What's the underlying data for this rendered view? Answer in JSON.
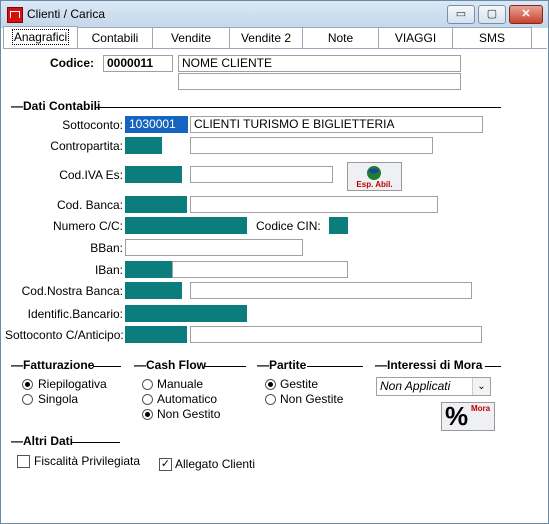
{
  "window": {
    "title": "Clienti / Carica",
    "controls": {
      "minimize": "▭",
      "maximize": "▢",
      "close": "✕"
    }
  },
  "tabs": [
    "Anagrafici",
    "Contabili",
    "Vendite",
    "Vendite 2",
    "Note",
    "VIAGGI",
    "SMS"
  ],
  "header": {
    "codice_label": "Codice:",
    "codice_value": "0000011",
    "nome_value": "NOME CLIENTE",
    "nome_value_2": ""
  },
  "dati_contabili": {
    "title": "Dati Contabili",
    "sottoconto_label": "Sottoconto:",
    "sottoconto_code": "1030001",
    "sottoconto_desc": "CLIENTI  TURISMO E BIGLIETTERIA",
    "contropartita_label": "Contropartita:",
    "codiva_label": "Cod.IVA Es:",
    "esp_abil_label": "Esp. Abil.",
    "codbanca_label": "Cod. Banca:",
    "numerocc_label": "Numero C/C:",
    "codicecin_label": "Codice CIN:",
    "bban_label": "BBan:",
    "iban_label": "IBan:",
    "codnostrabanca_label": "Cod.Nostra Banca:",
    "identific_label": "Identific.Bancario:",
    "sottoconto_anticipo_label": "Sottoconto C/Anticipo:"
  },
  "fatturazione": {
    "title": "Fatturazione",
    "options": [
      "Riepilogativa",
      "Singola"
    ],
    "selected": 0
  },
  "cash_flow": {
    "title": "Cash Flow",
    "options": [
      "Manuale",
      "Automatico",
      "Non Gestito"
    ],
    "selected": 2
  },
  "partite": {
    "title": "Partite",
    "options": [
      "Gestite",
      "Non Gestite"
    ],
    "selected": 0
  },
  "interessi_mora": {
    "title": "Interessi di Mora",
    "select_value": "Non Applicati",
    "button_label": "Mora",
    "button_symbol": "%"
  },
  "altri_dati": {
    "title": "Altri Dati",
    "fiscalita_label": "Fiscalità Privilegiata",
    "fiscalita_checked": false,
    "allegato_label": "Allegato Clienti",
    "allegato_checked": true
  },
  "colors": {
    "accent_field": "#0c7d7d",
    "selection": "#1565c0",
    "title_bar": "#c4d6ea"
  }
}
